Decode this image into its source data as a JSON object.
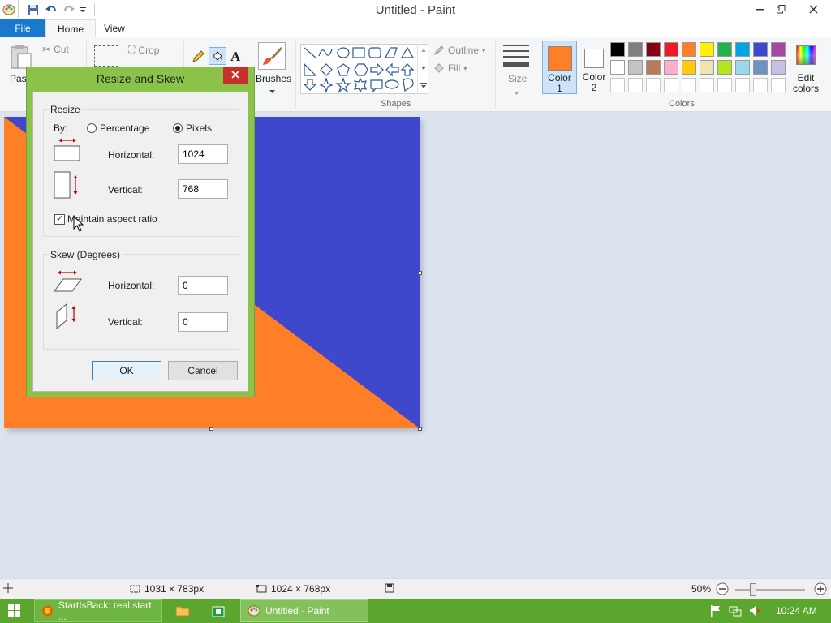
{
  "window": {
    "title": "Untitled - Paint"
  },
  "tabs": {
    "file": "File",
    "home": "Home",
    "view": "View"
  },
  "ribbon": {
    "clipboard": {
      "paste": "Paste",
      "cut": "Cut",
      "copy": "Copy"
    },
    "image": {
      "crop": "Crop"
    },
    "tools": {
      "brushes": "Brushes"
    },
    "shapes": {
      "outline": "Outline",
      "fill": "Fill",
      "group_label": "Shapes"
    },
    "size": {
      "label": "Size"
    },
    "color1": {
      "label_line1": "Color",
      "label_line2": "1",
      "value": "#fe7f26"
    },
    "color2": {
      "label_line1": "Color",
      "label_line2": "2",
      "value": "#ffffff"
    },
    "colors_group_label": "Colors",
    "edit_colors": {
      "line1": "Edit",
      "line2": "colors"
    },
    "palette_row1": [
      "#000000",
      "#7f7f7f",
      "#880015",
      "#ed1c24",
      "#ff7f27",
      "#fff200",
      "#22b14c",
      "#00a2e8",
      "#3f48cc",
      "#a349a4"
    ],
    "palette_row2": [
      "#ffffff",
      "#c3c3c3",
      "#b97a57",
      "#ffaec9",
      "#ffc90e",
      "#efe4b0",
      "#b5e61d",
      "#99d9ea",
      "#7092be",
      "#c8bfe7"
    ]
  },
  "canvas": {
    "colors": {
      "orange": "#fe7f26",
      "blue": "#3f48cc"
    }
  },
  "dialog": {
    "title": "Resize and Skew",
    "resize_legend": "Resize",
    "by_label": "By:",
    "percentage_label": "Percentage",
    "pixels_label": "Pixels",
    "selected_mode": "Pixels",
    "resize_horizontal_label": "Horizontal:",
    "resize_horizontal_value": "1024",
    "resize_vertical_label": "Vertical:",
    "resize_vertical_value": "768",
    "maintain_aspect_label": "Maintain aspect ratio",
    "maintain_aspect_checked": true,
    "skew_legend": "Skew (Degrees)",
    "skew_horizontal_label": "Horizontal:",
    "skew_horizontal_value": "0",
    "skew_vertical_label": "Vertical:",
    "skew_vertical_value": "0",
    "ok_label": "OK",
    "cancel_label": "Cancel"
  },
  "statusbar": {
    "selection_size": "1031 × 783px",
    "image_size": "1024 × 768px",
    "zoom": "50%"
  },
  "taskbar": {
    "browser_task": "StartIsBack: real start ...",
    "paint_task": "Untitled - Paint",
    "clock": "10:24 AM"
  }
}
